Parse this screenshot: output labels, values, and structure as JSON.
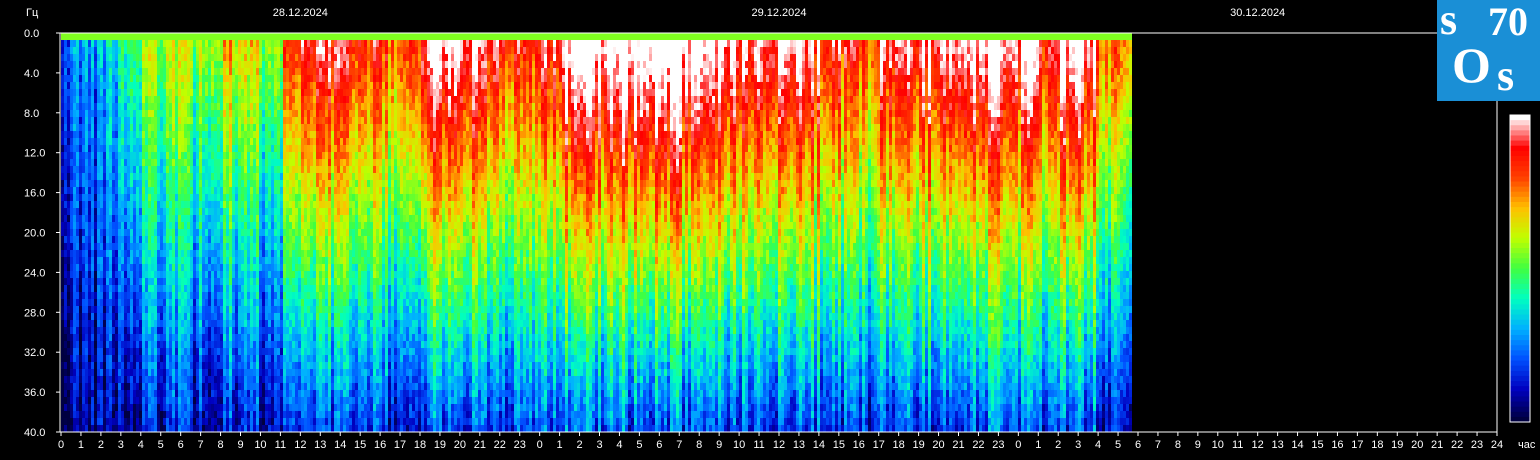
{
  "logo": {
    "s1": "s",
    "seventy": "70",
    "o": "O",
    "s2": "s",
    "bg_color": "#1a8fd6"
  },
  "chart_data": {
    "type": "heatmap",
    "title": "",
    "ylabel": "Гц",
    "xlabel": "час",
    "ylim": [
      0,
      40
    ],
    "y_ticks": [
      "0.0",
      "4.0",
      "8.0",
      "12.0",
      "16.0",
      "20.0",
      "24.0",
      "28.0",
      "32.0",
      "36.0",
      "40.0"
    ],
    "dates": [
      "28.12.2024",
      "29.12.2024",
      "30.12.2024"
    ],
    "x_ticks": [
      "0",
      "1",
      "2",
      "3",
      "4",
      "5",
      "6",
      "7",
      "8",
      "9",
      "10",
      "11",
      "12",
      "13",
      "14",
      "15",
      "16",
      "17",
      "18",
      "19",
      "20",
      "21",
      "22",
      "23",
      "0",
      "1",
      "2",
      "3",
      "4",
      "5",
      "6",
      "7",
      "8",
      "9",
      "10",
      "11",
      "12",
      "13",
      "14",
      "15",
      "16",
      "17",
      "18",
      "19",
      "20",
      "21",
      "22",
      "23",
      "0",
      "1",
      "2",
      "3",
      "4",
      "5",
      "6",
      "7",
      "8",
      "9",
      "10",
      "11",
      "12",
      "13",
      "14",
      "15",
      "16",
      "17",
      "18",
      "19",
      "20",
      "21",
      "22",
      "23",
      "24"
    ],
    "data_end_hours": 53.6,
    "total_hours": 72,
    "color_scale": [
      "#000040",
      "#0000c0",
      "#0050ff",
      "#00b0ff",
      "#00ffc0",
      "#40ff40",
      "#c0ff00",
      "#ffc000",
      "#ff4000",
      "#ff0000",
      "#ffffff"
    ],
    "intensity_by_hour": [
      0.22,
      0.22,
      0.28,
      0.45,
      0.5,
      0.52,
      0.5,
      0.55,
      0.6,
      0.55,
      0.5,
      0.72,
      0.8,
      0.82,
      0.78,
      0.75,
      0.72,
      0.8,
      0.9,
      0.92,
      0.88,
      0.82,
      0.75,
      0.72,
      0.8,
      0.92,
      0.95,
      0.92,
      0.98,
      1.0,
      0.98,
      0.95,
      0.92,
      0.9,
      0.85,
      0.88,
      0.92,
      0.85,
      0.8,
      0.75,
      0.72,
      0.85,
      0.82,
      0.88,
      0.9,
      0.92,
      0.9,
      0.85,
      0.92,
      0.8,
      0.95,
      0.88,
      0.72,
      0.7
    ]
  }
}
